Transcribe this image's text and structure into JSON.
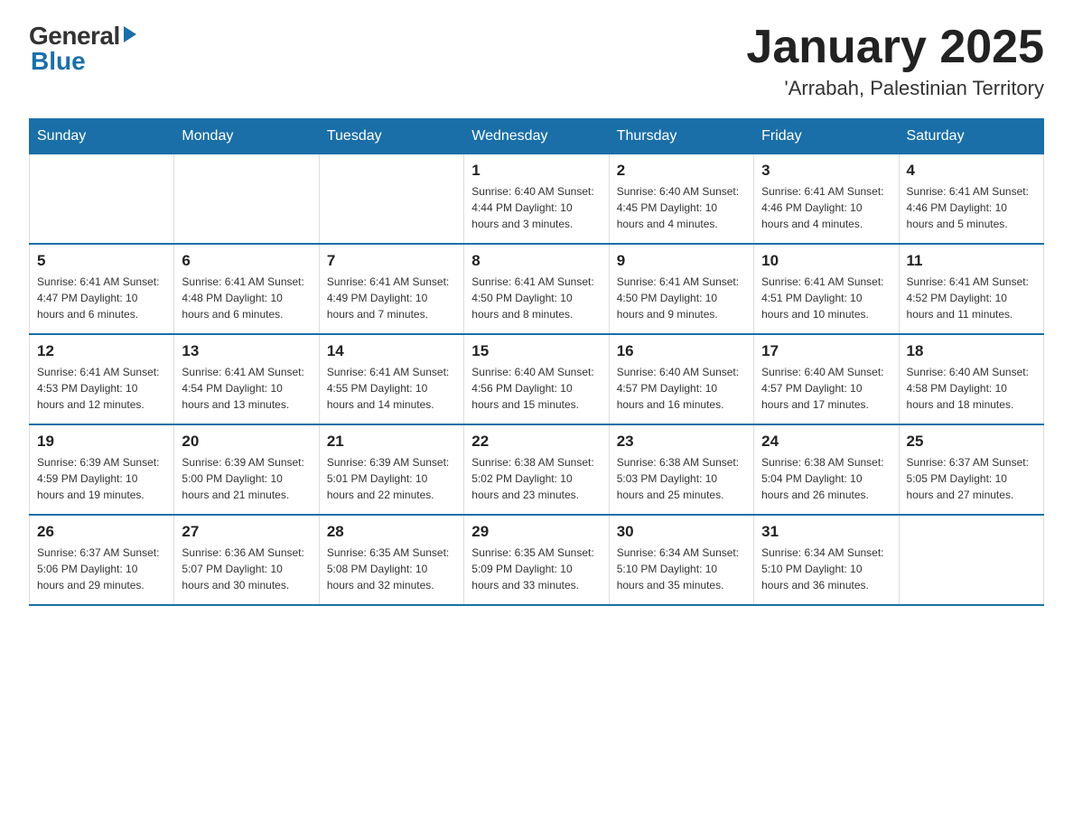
{
  "logo": {
    "general": "General",
    "blue": "Blue"
  },
  "title": "January 2025",
  "location": "'Arrabah, Palestinian Territory",
  "weekdays": [
    "Sunday",
    "Monday",
    "Tuesday",
    "Wednesday",
    "Thursday",
    "Friday",
    "Saturday"
  ],
  "weeks": [
    [
      {
        "day": "",
        "info": ""
      },
      {
        "day": "",
        "info": ""
      },
      {
        "day": "",
        "info": ""
      },
      {
        "day": "1",
        "info": "Sunrise: 6:40 AM\nSunset: 4:44 PM\nDaylight: 10 hours and 3 minutes."
      },
      {
        "day": "2",
        "info": "Sunrise: 6:40 AM\nSunset: 4:45 PM\nDaylight: 10 hours and 4 minutes."
      },
      {
        "day": "3",
        "info": "Sunrise: 6:41 AM\nSunset: 4:46 PM\nDaylight: 10 hours and 4 minutes."
      },
      {
        "day": "4",
        "info": "Sunrise: 6:41 AM\nSunset: 4:46 PM\nDaylight: 10 hours and 5 minutes."
      }
    ],
    [
      {
        "day": "5",
        "info": "Sunrise: 6:41 AM\nSunset: 4:47 PM\nDaylight: 10 hours and 6 minutes."
      },
      {
        "day": "6",
        "info": "Sunrise: 6:41 AM\nSunset: 4:48 PM\nDaylight: 10 hours and 6 minutes."
      },
      {
        "day": "7",
        "info": "Sunrise: 6:41 AM\nSunset: 4:49 PM\nDaylight: 10 hours and 7 minutes."
      },
      {
        "day": "8",
        "info": "Sunrise: 6:41 AM\nSunset: 4:50 PM\nDaylight: 10 hours and 8 minutes."
      },
      {
        "day": "9",
        "info": "Sunrise: 6:41 AM\nSunset: 4:50 PM\nDaylight: 10 hours and 9 minutes."
      },
      {
        "day": "10",
        "info": "Sunrise: 6:41 AM\nSunset: 4:51 PM\nDaylight: 10 hours and 10 minutes."
      },
      {
        "day": "11",
        "info": "Sunrise: 6:41 AM\nSunset: 4:52 PM\nDaylight: 10 hours and 11 minutes."
      }
    ],
    [
      {
        "day": "12",
        "info": "Sunrise: 6:41 AM\nSunset: 4:53 PM\nDaylight: 10 hours and 12 minutes."
      },
      {
        "day": "13",
        "info": "Sunrise: 6:41 AM\nSunset: 4:54 PM\nDaylight: 10 hours and 13 minutes."
      },
      {
        "day": "14",
        "info": "Sunrise: 6:41 AM\nSunset: 4:55 PM\nDaylight: 10 hours and 14 minutes."
      },
      {
        "day": "15",
        "info": "Sunrise: 6:40 AM\nSunset: 4:56 PM\nDaylight: 10 hours and 15 minutes."
      },
      {
        "day": "16",
        "info": "Sunrise: 6:40 AM\nSunset: 4:57 PM\nDaylight: 10 hours and 16 minutes."
      },
      {
        "day": "17",
        "info": "Sunrise: 6:40 AM\nSunset: 4:57 PM\nDaylight: 10 hours and 17 minutes."
      },
      {
        "day": "18",
        "info": "Sunrise: 6:40 AM\nSunset: 4:58 PM\nDaylight: 10 hours and 18 minutes."
      }
    ],
    [
      {
        "day": "19",
        "info": "Sunrise: 6:39 AM\nSunset: 4:59 PM\nDaylight: 10 hours and 19 minutes."
      },
      {
        "day": "20",
        "info": "Sunrise: 6:39 AM\nSunset: 5:00 PM\nDaylight: 10 hours and 21 minutes."
      },
      {
        "day": "21",
        "info": "Sunrise: 6:39 AM\nSunset: 5:01 PM\nDaylight: 10 hours and 22 minutes."
      },
      {
        "day": "22",
        "info": "Sunrise: 6:38 AM\nSunset: 5:02 PM\nDaylight: 10 hours and 23 minutes."
      },
      {
        "day": "23",
        "info": "Sunrise: 6:38 AM\nSunset: 5:03 PM\nDaylight: 10 hours and 25 minutes."
      },
      {
        "day": "24",
        "info": "Sunrise: 6:38 AM\nSunset: 5:04 PM\nDaylight: 10 hours and 26 minutes."
      },
      {
        "day": "25",
        "info": "Sunrise: 6:37 AM\nSunset: 5:05 PM\nDaylight: 10 hours and 27 minutes."
      }
    ],
    [
      {
        "day": "26",
        "info": "Sunrise: 6:37 AM\nSunset: 5:06 PM\nDaylight: 10 hours and 29 minutes."
      },
      {
        "day": "27",
        "info": "Sunrise: 6:36 AM\nSunset: 5:07 PM\nDaylight: 10 hours and 30 minutes."
      },
      {
        "day": "28",
        "info": "Sunrise: 6:35 AM\nSunset: 5:08 PM\nDaylight: 10 hours and 32 minutes."
      },
      {
        "day": "29",
        "info": "Sunrise: 6:35 AM\nSunset: 5:09 PM\nDaylight: 10 hours and 33 minutes."
      },
      {
        "day": "30",
        "info": "Sunrise: 6:34 AM\nSunset: 5:10 PM\nDaylight: 10 hours and 35 minutes."
      },
      {
        "day": "31",
        "info": "Sunrise: 6:34 AM\nSunset: 5:10 PM\nDaylight: 10 hours and 36 minutes."
      },
      {
        "day": "",
        "info": ""
      }
    ]
  ]
}
